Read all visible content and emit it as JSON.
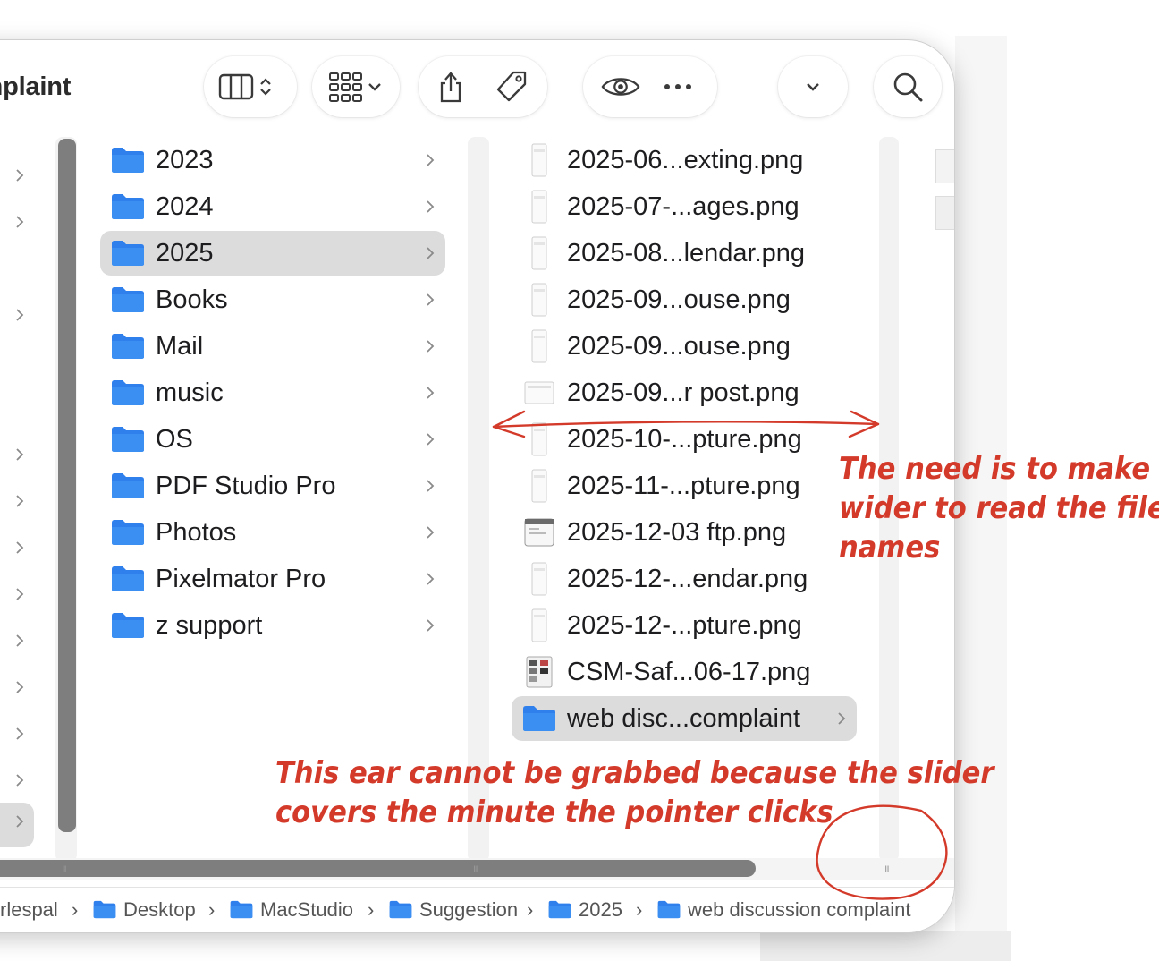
{
  "window": {
    "title": "omplaint"
  },
  "toolbar": {
    "view_mode_icon": "columns-view-icon",
    "group_icon": "group-by-icon",
    "share_icon": "share-icon",
    "tag_icon": "tag-icon",
    "quicklook_icon": "eye-icon",
    "more_icon": "ellipsis-icon",
    "dropdown_icon": "chevron-down-icon",
    "search_icon": "search-icon"
  },
  "column_folders": {
    "items": [
      {
        "label": "2023",
        "selected": false
      },
      {
        "label": "2024",
        "selected": false
      },
      {
        "label": "2025",
        "selected": true
      },
      {
        "label": "Books",
        "selected": false
      },
      {
        "label": "Mail",
        "selected": false
      },
      {
        "label": "music",
        "selected": false
      },
      {
        "label": "OS",
        "selected": false
      },
      {
        "label": "PDF Studio Pro",
        "selected": false
      },
      {
        "label": "Photos",
        "selected": false
      },
      {
        "label": "Pixelmator Pro",
        "selected": false
      },
      {
        "label": "z support",
        "selected": false
      }
    ]
  },
  "column_files": {
    "items": [
      {
        "label": "2025-06...exting.png",
        "kind": "file"
      },
      {
        "label": "2025-07-...ages.png",
        "kind": "file"
      },
      {
        "label": "2025-08...lendar.png",
        "kind": "file"
      },
      {
        "label": "2025-09...ouse.png",
        "kind": "file"
      },
      {
        "label": "2025-09...ouse.png",
        "kind": "file"
      },
      {
        "label": "2025-09...r post.png",
        "kind": "file"
      },
      {
        "label": "2025-10-...pture.png",
        "kind": "file"
      },
      {
        "label": "2025-11-...pture.png",
        "kind": "file"
      },
      {
        "label": "2025-12-03 ftp.png",
        "kind": "file"
      },
      {
        "label": "2025-12-...endar.png",
        "kind": "file"
      },
      {
        "label": "2025-12-...pture.png",
        "kind": "file"
      },
      {
        "label": "CSM-Saf...06-17.png",
        "kind": "file"
      },
      {
        "label": "web disc...complaint",
        "kind": "folder",
        "selected": true
      }
    ]
  },
  "pathbar": {
    "crumbs": [
      {
        "label": "rlespal",
        "icon": ""
      },
      {
        "label": "Desktop",
        "icon": "folder-icon"
      },
      {
        "label": "MacStudio",
        "icon": "folder-icon"
      },
      {
        "label": "Suggestion",
        "icon": "folder-icon"
      },
      {
        "label": "2025",
        "icon": "folder-icon"
      },
      {
        "label": "web discussion complaint",
        "icon": "folder-icon"
      }
    ],
    "separator": "›"
  },
  "annotations": {
    "width_note": [
      "The need is to make",
      "wider to read the file",
      "names"
    ],
    "ear_note": [
      "This ear cannot be grabbed because the slider",
      "covers the minute the pointer clicks"
    ],
    "color": "#d43a2a"
  },
  "colors": {
    "folder_blue": "#2f80ed",
    "selection_gray": "#dcdcdc",
    "scroll_thumb": "#7e7e7e"
  }
}
